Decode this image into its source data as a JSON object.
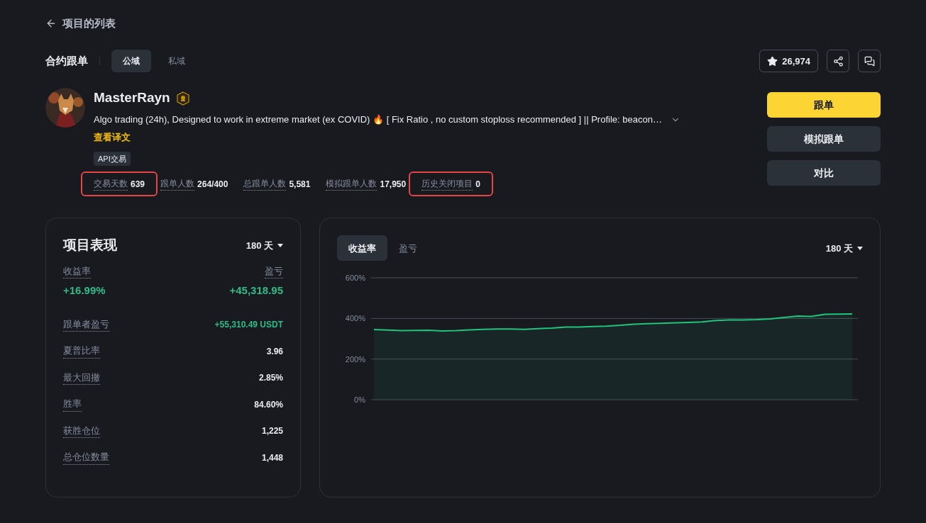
{
  "back_link": "项目的列表",
  "header": {
    "title": "合约跟单",
    "tabs": [
      {
        "label": "公域",
        "selected": true
      },
      {
        "label": "私域",
        "selected": false
      }
    ],
    "favorites": "26,974"
  },
  "profile": {
    "name": "MasterRayn",
    "description": "Algo trading (24h), Designed to work in extreme market (ex COVID) 🔥 [ Fix Ratio , no custom stoploss recommended ] || Profile: beacon…",
    "translate_link": "查看译文",
    "tags": [
      "API交易"
    ],
    "stats": [
      {
        "label": "交易天数",
        "value": "639",
        "highlighted": true
      },
      {
        "label": "跟单人数",
        "value": "264/400",
        "highlighted": false
      },
      {
        "label": "总跟单人数",
        "value": "5,581",
        "highlighted": false
      },
      {
        "label": "模拟跟单人数",
        "value": "17,950",
        "highlighted": false
      },
      {
        "label": "历史关闭项目",
        "value": "0",
        "highlighted": true
      }
    ]
  },
  "actions": [
    {
      "label": "跟单",
      "kind": "primary"
    },
    {
      "label": "模拟跟单",
      "kind": "secondary"
    },
    {
      "label": "对比",
      "kind": "secondary"
    }
  ],
  "performance": {
    "title": "项目表现",
    "period": "180 天",
    "headline": [
      {
        "label": "收益率",
        "value": "+16.99%"
      },
      {
        "label": "盈亏",
        "value": "+45,318.95"
      }
    ],
    "rows": [
      {
        "label": "跟单者盈亏",
        "value": "+55,310.49 USDT",
        "positive": true
      },
      {
        "label": "夏普比率",
        "value": "3.96",
        "positive": false
      },
      {
        "label": "最大回撤",
        "value": "2.85%",
        "positive": false
      },
      {
        "label": "胜率",
        "value": "84.60%",
        "positive": false
      },
      {
        "label": "获胜仓位",
        "value": "1,225",
        "positive": false
      },
      {
        "label": "总仓位数量",
        "value": "1,448",
        "positive": false
      }
    ]
  },
  "chart_panel": {
    "tabs": [
      {
        "label": "收益率",
        "selected": true
      },
      {
        "label": "盈亏",
        "selected": false
      }
    ],
    "period": "180 天",
    "chart_data": {
      "type": "area",
      "ylim": [
        0,
        600
      ],
      "yticks": [
        {
          "value": 0,
          "label": "0%"
        },
        {
          "value": 200,
          "label": "200%"
        },
        {
          "value": 400,
          "label": "400%"
        },
        {
          "value": 600,
          "label": "600%"
        }
      ],
      "series": [
        {
          "color": "#20c57c",
          "values": [
            345,
            343,
            340,
            341,
            342,
            338,
            340,
            344,
            346,
            348,
            348,
            346,
            350,
            352,
            358,
            358,
            360,
            362,
            366,
            372,
            374,
            376,
            378,
            380,
            383,
            390,
            392,
            392,
            394,
            398,
            405,
            412,
            410,
            420,
            421,
            422
          ]
        }
      ]
    }
  }
}
